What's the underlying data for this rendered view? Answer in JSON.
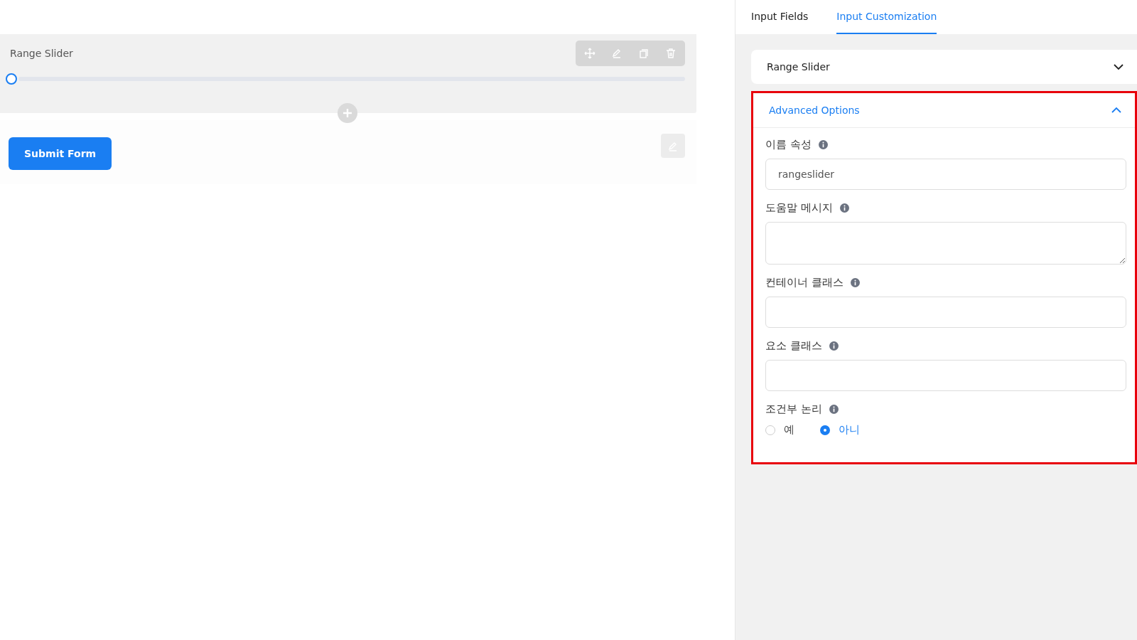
{
  "canvas": {
    "field": {
      "label": "Range Slider",
      "level": 0
    },
    "submit_button": "Submit Form"
  },
  "tabs": [
    {
      "label": "Input Fields",
      "selected": false
    },
    {
      "label": "Input Customization",
      "selected": true
    }
  ],
  "accordions": [
    {
      "title": "Range Slider",
      "expanded": false,
      "highlighted": false
    },
    {
      "title": "Advanced Options",
      "expanded": true,
      "highlighted": true,
      "fields": [
        {
          "kind": "input",
          "label": "이름 속성",
          "value": "rangeslider"
        },
        {
          "kind": "textarea",
          "label": "도움말 메시지"
        },
        {
          "kind": "input",
          "label": "컨테이너 클래스"
        },
        {
          "kind": "input",
          "label": "요소 클래스"
        },
        {
          "kind": "radio",
          "label": "조건부 논리",
          "options": [
            {
              "label": "예",
              "selected": false
            },
            {
              "label": "아니",
              "selected": true
            }
          ]
        }
      ]
    }
  ]
}
